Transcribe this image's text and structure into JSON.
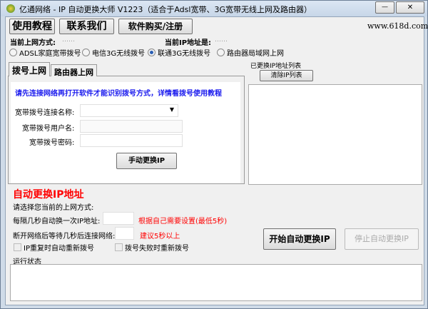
{
  "window": {
    "title": "亿通网络 - IP 自动更换大师 V1223（适合于Adsl宽带、3G宽带无线上网及路由器）",
    "minimize": "—",
    "close": "✕"
  },
  "toolbar": {
    "tutorial": "使用教程",
    "contact": "联系我们",
    "buy": "软件购买/注册",
    "website": "www.618d.com"
  },
  "status": {
    "mode_label": "当前上网方式:",
    "mode_value": "……",
    "ip_label": "当前IP地址是:",
    "ip_value": "……"
  },
  "modes": [
    {
      "label": "ADSL家庭宽带拨号",
      "checked": false
    },
    {
      "label": "电信3G无线拨号",
      "checked": false
    },
    {
      "label": "联通3G无线拨号",
      "checked": true
    },
    {
      "label": "路由器局域网上网",
      "checked": false
    }
  ],
  "tabs": [
    {
      "label": "拨号上网",
      "active": true
    },
    {
      "label": "路由器上网",
      "active": false
    }
  ],
  "dial": {
    "notice": "请先连接网络再打开软件才能识别拨号方式，详情看拨号使用教程",
    "conn_name_label": "宽带拨号连接名称:",
    "user_label": "宽带拨号用户名:",
    "pass_label": "宽带拨号密码:",
    "conn_name": "",
    "user": "",
    "pass": "",
    "manual_button": "手动更换IP"
  },
  "iplist": {
    "title": "已更换IP地址列表",
    "clear_button": "清除IP列表",
    "items": []
  },
  "auto": {
    "header": "自动更换IP地址",
    "prompt": "请选择您当前的上网方式:",
    "interval_label": "每隔几秒自动换一次IP地址:",
    "interval_value": "",
    "interval_hint": "根据自己需要设置(最低5秒)",
    "wait_label": "断开网络后等待几秒后连接网络:",
    "wait_value": "",
    "wait_hint": "建议5秒以上",
    "chk_repeat": "IP重复时自动重新拨号",
    "chk_fail": "拨号失败时重新拨号",
    "start_button": "开始自动更换IP",
    "stop_button": "停止自动更换IP"
  },
  "log": {
    "label": "运行状态",
    "text": ""
  }
}
